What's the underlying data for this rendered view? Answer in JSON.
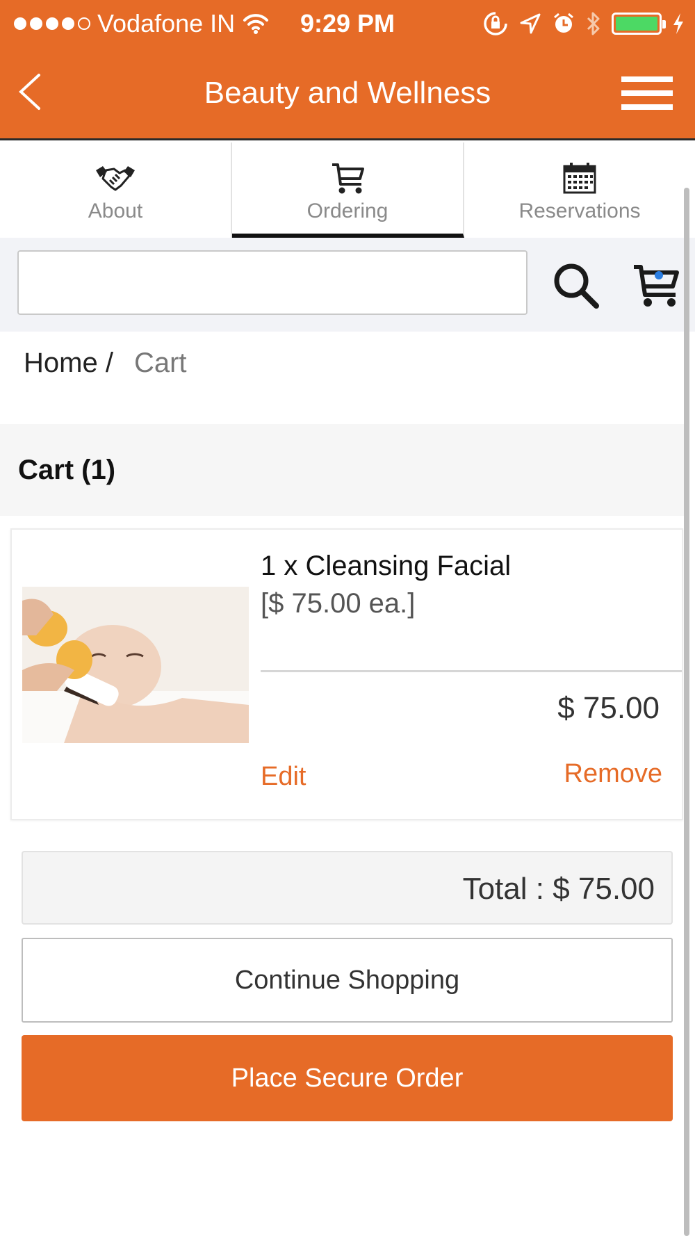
{
  "status_bar": {
    "carrier": "Vodafone IN",
    "time": "9:29 PM",
    "signal_bars": 4,
    "battery_level": 1.0,
    "battery_color": "#4cd964"
  },
  "nav": {
    "title": "Beauty and Wellness",
    "back_icon": "chevron-left-icon",
    "menu_icon": "hamburger-menu-icon"
  },
  "tabs": [
    {
      "label": "About",
      "icon": "handshake-icon",
      "active": false
    },
    {
      "label": "Ordering",
      "icon": "cart-icon",
      "active": true
    },
    {
      "label": "Reservations",
      "icon": "calendar-icon",
      "active": false
    }
  ],
  "search": {
    "value": "",
    "placeholder": ""
  },
  "breadcrumb": {
    "home": "Home /",
    "current": "Cart"
  },
  "cart": {
    "title": "Cart (1)",
    "items": [
      {
        "name": "1 x Cleansing Facial",
        "unit_price": "[$ 75.00 ea.]",
        "price": "$ 75.00",
        "edit_label": "Edit",
        "remove_label": "Remove"
      }
    ],
    "total": "Total : $ 75.00",
    "continue_label": "Continue Shopping",
    "order_label": "Place Secure Order"
  },
  "colors": {
    "accent": "#e66b27"
  }
}
